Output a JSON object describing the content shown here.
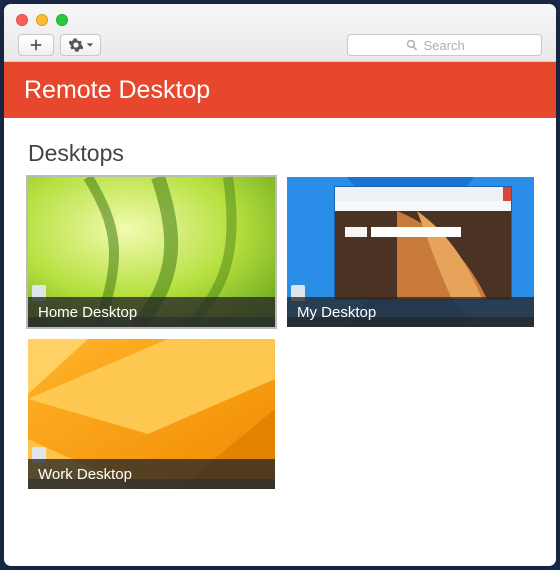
{
  "banner_title": "Remote Desktop",
  "search": {
    "placeholder": "Search",
    "value": ""
  },
  "section_title": "Desktops",
  "desktops": [
    {
      "label": "Home Desktop",
      "selected": true
    },
    {
      "label": "My Desktop",
      "selected": false
    },
    {
      "label": "Work Desktop",
      "selected": false
    }
  ]
}
